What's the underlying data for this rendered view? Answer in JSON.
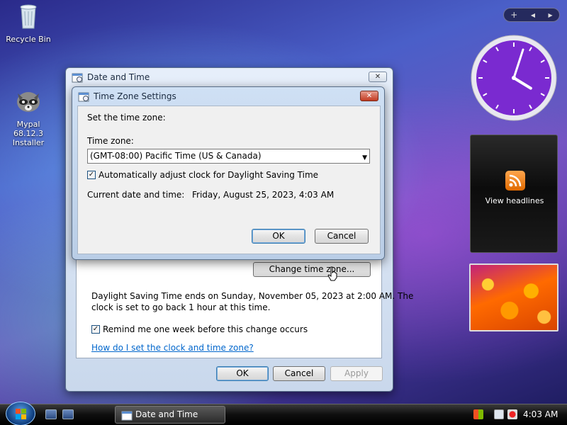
{
  "desktop": {
    "icons": [
      {
        "label": "Recycle Bin",
        "icon": "recycle-bin-icon"
      },
      {
        "label": "Mypal 68.12.3 Installer",
        "icon": "raccoon-icon"
      }
    ]
  },
  "sidebar": {
    "add_button": "+",
    "prev_button": "◀",
    "next_button": "▶",
    "clock": {
      "hour": 4,
      "minute": 3
    },
    "feed_label": "View headlines"
  },
  "date_time_window": {
    "title": "Date and Time",
    "close_label": "✕",
    "change_timezone_button": "Change time zone...",
    "dst_message_line1": "Daylight Saving Time ends on Sunday, November 05, 2023 at 2:00 AM. The",
    "dst_message_line2": "clock is set to go back 1 hour at this time.",
    "remind_label": "Remind me one week before this change occurs",
    "remind_checked": true,
    "help_link": "How do I set the clock and time zone?",
    "ok_button": "OK",
    "cancel_button": "Cancel",
    "apply_button": "Apply"
  },
  "timezone_dialog": {
    "title": "Time Zone Settings",
    "close_label": "✕",
    "set_label": "Set the time zone:",
    "timezone_label": "Time zone:",
    "timezone_value": "(GMT-08:00) Pacific Time (US & Canada)",
    "auto_dst_label": "Automatically adjust clock for Daylight Saving Time",
    "auto_dst_checked": true,
    "current_label": "Current date and time:",
    "current_value": "Friday, August 25, 2023, 4:03 AM",
    "ok_button": "OK",
    "cancel_button": "Cancel"
  },
  "taskbar": {
    "task_label": "Date and Time",
    "time": "4:03 AM"
  },
  "colors": {
    "accent": "#3c7fb1",
    "link": "#0066cc",
    "clock_face": "#7a2ad0"
  }
}
